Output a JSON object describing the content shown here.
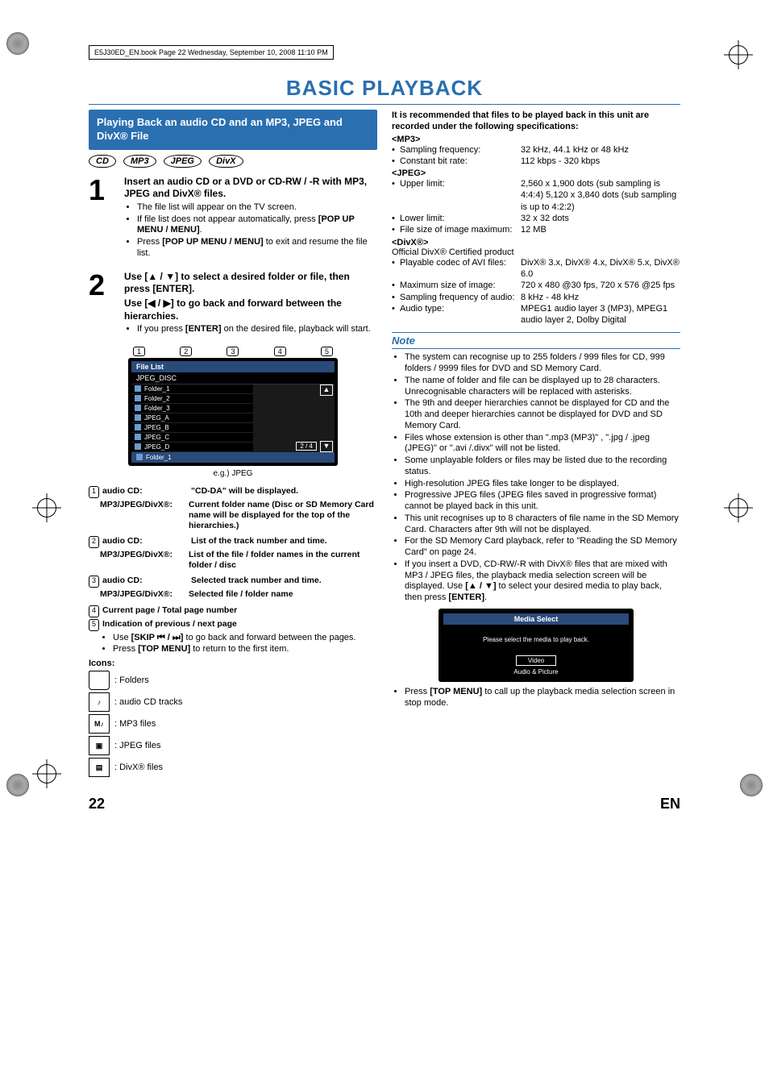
{
  "header_line": "E5J30ED_EN.book  Page 22  Wednesday, September 10, 2008  11:10 PM",
  "page_title": "BASIC PLAYBACK",
  "section_title": "Playing Back an audio CD and an MP3, JPEG and DivX® File",
  "badges": [
    "CD",
    "MP3",
    "JPEG",
    "DivX"
  ],
  "steps": [
    {
      "num": "1",
      "title": "Insert an audio CD or a DVD or CD-RW / -R with MP3, JPEG and DivX® files.",
      "bullets": [
        "The file list will appear on the TV screen.",
        "If file list does not appear automatically, press [POP UP MENU / MENU].",
        "Press [POP UP MENU / MENU] to exit and resume the file list."
      ]
    },
    {
      "num": "2",
      "title_line1": "Use [▲ / ▼] to select a desired folder or file, then press [ENTER].",
      "title_line2": "Use [◀ / ▶] to go back and forward between the hierarchies.",
      "bullets": [
        "If you press [ENTER] on the desired file, playback will start."
      ]
    }
  ],
  "callouts": [
    "1",
    "2",
    "3",
    "4",
    "5"
  ],
  "file_list": {
    "title": "File List",
    "sub": "JPEG_DISC",
    "items": [
      "Folder_1",
      "Folder_2",
      "Folder_3",
      "JPEG_A",
      "JPEG_B",
      "JPEG_C",
      "JPEG_D"
    ],
    "page": "2 /    4",
    "footer": "Folder_1"
  },
  "caption": "e.g.) JPEG",
  "legend": [
    {
      "n": "1",
      "label": "audio CD:",
      "text": "\"CD-DA\" will be displayed.",
      "sub_label": "MP3/JPEG/DivX®:",
      "sub_text": "Current folder name (Disc or SD Memory Card name will be displayed for the top of the hierarchies.)"
    },
    {
      "n": "2",
      "label": "audio CD:",
      "text": "List of the track number and time.",
      "sub_label": "MP3/JPEG/DivX®:",
      "sub_text": "List of the file / folder names in the current folder / disc"
    },
    {
      "n": "3",
      "label": "audio CD:",
      "text": "Selected track number and time.",
      "sub_label": "MP3/JPEG/DivX®:",
      "sub_text": "Selected file / folder name"
    },
    {
      "n": "4",
      "label": "",
      "text": "Current page / Total page number"
    },
    {
      "n": "5",
      "label": "",
      "text": "Indication of previous / next page",
      "extra": [
        "Use [SKIP ⏮ / ⏭] to go back and forward between the pages.",
        "Press [TOP MENU] to return to the first item."
      ]
    }
  ],
  "icons_label": "Icons:",
  "icons": [
    {
      "name": "folder-icon",
      "text": ": Folders"
    },
    {
      "name": "cd-track-icon",
      "text": ": audio CD tracks"
    },
    {
      "name": "mp3-icon",
      "text": ": MP3 files"
    },
    {
      "name": "jpeg-icon",
      "text": ": JPEG files"
    },
    {
      "name": "divx-icon",
      "text": ": DivX® files"
    }
  ],
  "spec_intro": "It is recommended that files to be played back in this unit are recorded under the following specifications:",
  "spec_mp3_head": "<MP3>",
  "spec_mp3": [
    {
      "label": "Sampling frequency:",
      "val": "32 kHz, 44.1 kHz or 48 kHz"
    },
    {
      "label": "Constant bit rate:",
      "val": "112 kbps - 320 kbps"
    }
  ],
  "spec_jpeg_head": "<JPEG>",
  "spec_jpeg": [
    {
      "label": "Upper limit:",
      "val": "2,560 x 1,900 dots (sub sampling is 4:4:4) 5,120 x 3,840 dots (sub sampling is up to 4:2:2)"
    },
    {
      "label": "Lower limit:",
      "val": "32 x 32 dots"
    },
    {
      "label": "File size of image maximum:",
      "val": "12 MB"
    }
  ],
  "spec_divx_head": "<DivX®>",
  "spec_divx_sub": "Official DivX® Certified product",
  "spec_divx": [
    {
      "label": "Playable codec of AVI files:",
      "val": "DivX® 3.x, DivX® 4.x, DivX® 5.x, DivX® 6.0"
    },
    {
      "label": "Maximum size of image:",
      "val": "720 x 480 @30 fps, 720 x 576 @25 fps"
    },
    {
      "label": "Sampling frequency of audio:",
      "val": "8 kHz - 48 kHz"
    },
    {
      "label": "Audio type:",
      "val": "MPEG1 audio layer 3 (MP3), MPEG1 audio layer 2, Dolby Digital"
    }
  ],
  "note_head": "Note",
  "notes": [
    "The system can recognise up to 255 folders / 999 files for CD, 999 folders / 9999 files for DVD and SD Memory Card.",
    "The name of folder and file can be displayed up to 28 characters. Unrecognisable characters will be replaced with asterisks.",
    "The 9th and deeper hierarchies cannot be displayed for CD and the 10th and deeper hierarchies cannot be displayed for DVD and SD Memory Card.",
    "Files whose extension is other than \".mp3 (MP3)\" , \".jpg / .jpeg (JPEG)\" or \".avi /.divx\" will not be listed.",
    "Some unplayable folders or files may be listed due to the recording status.",
    "High-resolution JPEG files take longer to be displayed.",
    "Progressive JPEG files (JPEG files saved in progressive format) cannot be played back in this unit.",
    "This unit recognises up to 8 characters of file name in the SD Memory Card. Characters after 9th will not be displayed.",
    "For the SD Memory Card playback, refer to \"Reading the SD Memory Card\" on page 24.",
    "If you insert a DVD, CD-RW/-R with DivX® files that are mixed with MP3 / JPEG files, the playback media selection screen will be displayed. Use [▲ / ▼] to select your desired media to play back, then press [ENTER]."
  ],
  "media": {
    "title": "Media Select",
    "text": "Please select the media to play back.",
    "btn1": "Video",
    "btn2": "Audio & Picture"
  },
  "note_after": "Press [TOP MENU] to call up the playback media selection screen in stop mode.",
  "page_num": "22",
  "lang": "EN"
}
